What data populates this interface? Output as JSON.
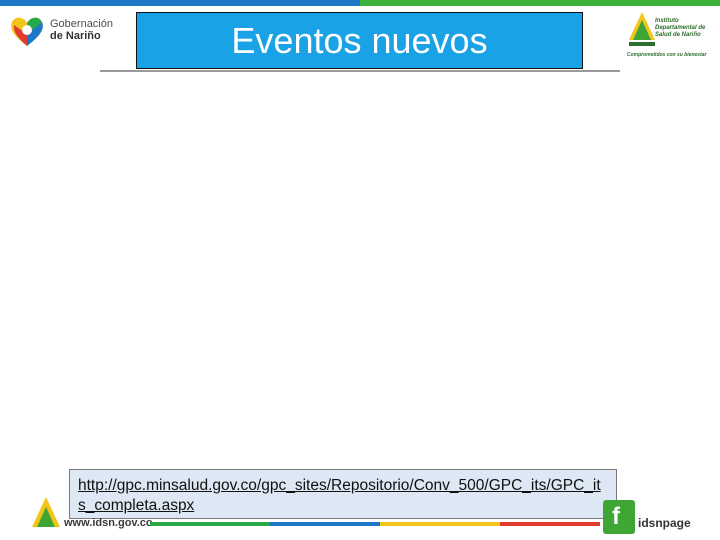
{
  "header": {
    "left_logo_line1": "Gobernación",
    "left_logo_line2": "de Nariño",
    "title": "Eventos nuevos",
    "right_logo_name": "Instituto Departamental de Salud de Nariño",
    "right_logo_slogan": "Comprometidos con su bienestar"
  },
  "content": {
    "link_text": "http://gpc.minsalud.gov.co/gpc_sites/Repositorio/Conv_500/GPC_its/GPC_its_completa.aspx"
  },
  "footer": {
    "url": "www.idsn.gov.co",
    "social_handle": "idsnpage"
  },
  "colors": {
    "title_bg": "#1aa2e6",
    "top_blue": "#1e78c8",
    "top_green": "#3cb13c"
  }
}
